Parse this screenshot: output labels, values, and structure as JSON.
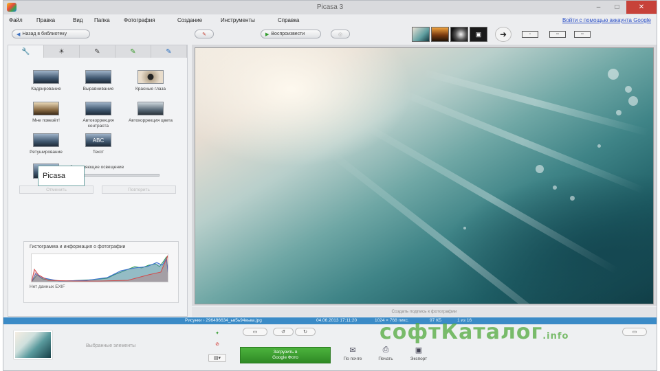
{
  "window": {
    "title": "Picasa 3",
    "google_link": "Войти с помощью аккаунта Google"
  },
  "menu": [
    "Файл",
    "Правка",
    "Вид",
    "Папка",
    "Фотография",
    "Создание",
    "Инструменты",
    "Справка"
  ],
  "toolbar": {
    "back_label": "Назад в библиотеку",
    "play_label": "Воспроизвести"
  },
  "tabs": [
    "wrench-icon",
    "sun-icon",
    "brush-icon",
    "brush-green-icon",
    "brush-blue-icon"
  ],
  "tools": [
    {
      "label": "Кадрирование"
    },
    {
      "label": "Выравнивание"
    },
    {
      "label": "Красные глаза"
    },
    {
      "label": "Мне повезёт!"
    },
    {
      "label": "Автокоррекция контраста"
    },
    {
      "label": "Автокоррекция цвета"
    },
    {
      "label": "Ретуширование"
    },
    {
      "label": "Текст"
    }
  ],
  "fill_light": {
    "label": "Заполняющее освещение",
    "level": 0
  },
  "undo_label": "Отменить",
  "redo_label": "Повторить",
  "overlay_label": "Picasa",
  "histogram": {
    "title": "Гистограмма и информация о фотографии",
    "note": "Нет данных EXIF"
  },
  "caption_placeholder": "Создать подпись к фотографии",
  "status": {
    "file": "Рисунки › 296496634_ьв5ь94вьва.jpg",
    "date": "04.06.2013 17:11:20",
    "size": "1024 × 768 пикс.",
    "kb": "97 КБ",
    "index": "1 из 16"
  },
  "tray": {
    "label": "Выбранные элементы"
  },
  "share_button": {
    "line1": "Загрузить в",
    "line2": "Google Фото"
  },
  "actions": [
    {
      "icon": "email-icon",
      "label": "По почте"
    },
    {
      "icon": "print-icon",
      "label": "Печать"
    },
    {
      "icon": "export-icon",
      "label": "Экспорт"
    }
  ],
  "watermark": {
    "text": "софтКаталог",
    "suffix": ".info"
  }
}
